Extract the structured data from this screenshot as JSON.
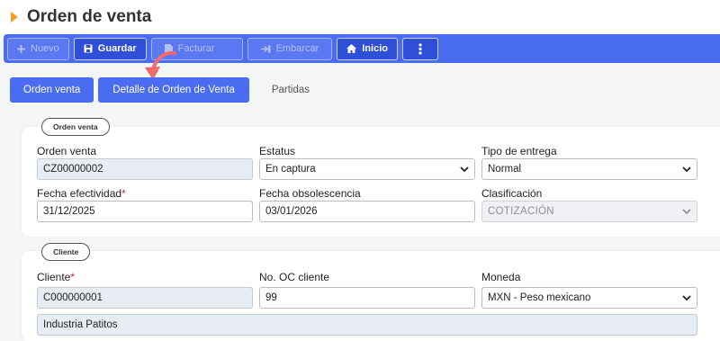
{
  "page": {
    "title": "Orden de venta"
  },
  "toolbar": {
    "nuevo": "Nuevo",
    "guardar": "Guardar",
    "facturar": "Facturar",
    "embarcar": "Embarcar",
    "inicio": "Inicio"
  },
  "tabs": {
    "orden_venta": "Orden venta",
    "detalle": "Detalle de Orden de Venta",
    "partidas": "Partidas"
  },
  "section_orden": {
    "badge": "Orden venta",
    "orden_venta_label": "Orden venta",
    "orden_venta_value": "CZ00000002",
    "estatus_label": "Estatus",
    "estatus_value": "En captura",
    "tipo_entrega_label": "Tipo de entrega",
    "tipo_entrega_value": "Normal",
    "fecha_efectividad_label": "Fecha efectividad",
    "fecha_efectividad_value": "31/12/2025",
    "fecha_obsolescencia_label": "Fecha obsolescencia",
    "fecha_obsolescencia_value": "03/01/2026",
    "clasificacion_label": "Clasificación",
    "clasificacion_value": "COTIZACIÓN"
  },
  "section_cliente": {
    "badge": "Cliente",
    "cliente_label": "Cliente",
    "cliente_value": "C000000001",
    "oc_label": "No. OC cliente",
    "oc_value": "99",
    "moneda_label": "Moneda",
    "moneda_value": "MXN - Peso mexicano",
    "cliente_nombre_value": "Industria Patitos"
  },
  "required_mark": "*",
  "colors": {
    "primary": "#4a6cf0",
    "accent": "#f0a020",
    "arrow": "#f06a6a",
    "required": "#d8263a"
  }
}
